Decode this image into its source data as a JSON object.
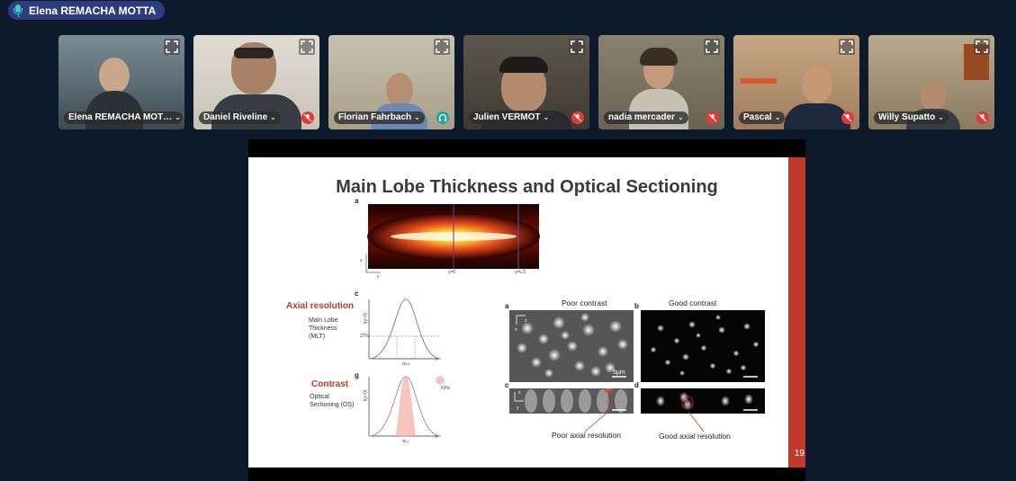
{
  "active_speaker": {
    "name": "Elena REMACHA MOTTA",
    "icon": "microphone-icon"
  },
  "participants": [
    {
      "name": "Elena REMACHA MOT…",
      "status": "none",
      "bg": "#5f6f78"
    },
    {
      "name": "Daniel Riveline",
      "status": "muted",
      "bg": "#d7d2c7"
    },
    {
      "name": "Florian Fahrbach",
      "status": "headphones",
      "bg": "#b9aa8f"
    },
    {
      "name": "Julien VERMOT",
      "status": "muted",
      "bg": "#5a5448"
    },
    {
      "name": "nadia mercader",
      "status": "muted",
      "bg": "#8a7f6c"
    },
    {
      "name": "Pascal",
      "status": "muted",
      "bg": "#a98565"
    },
    {
      "name": "Willy Supatto",
      "status": "muted",
      "bg": "#9e8b6f"
    }
  ],
  "slide": {
    "title": "Main Lobe Thickness and Optical Sectioning",
    "page_number": "19",
    "panel_labels": {
      "a_top": "a",
      "c_left": "c",
      "g_left": "g",
      "a_right": "a",
      "b_right": "b",
      "c_right": "c",
      "d_right": "d"
    },
    "heatmap_ticks": {
      "z": "z",
      "y": "y",
      "y0": "y=0",
      "yL2": "y=L/2"
    },
    "axial": {
      "heading": "Axial resolution",
      "desc": [
        "Main Lobe",
        "Thickness",
        "(MLT)"
      ],
      "pct": "37%",
      "w": "wₘₗₜ",
      "x": "x",
      "ylab": "I(y=0)"
    },
    "contrast": {
      "heading": "Contrast",
      "desc": [
        "Optical",
        "Sectioning (OS)"
      ],
      "pct": "63%",
      "w": "wₒₛ",
      "x": "x",
      "ylab": "I(y=0)"
    },
    "poor_contrast": "Poor contrast",
    "good_contrast": "Good contrast",
    "scale": "5µm",
    "poor_axial": "Poor axial resolution",
    "good_axial": "Good axial resolution",
    "axes_z": "z",
    "axes_x": "x",
    "axes_y": "y"
  }
}
